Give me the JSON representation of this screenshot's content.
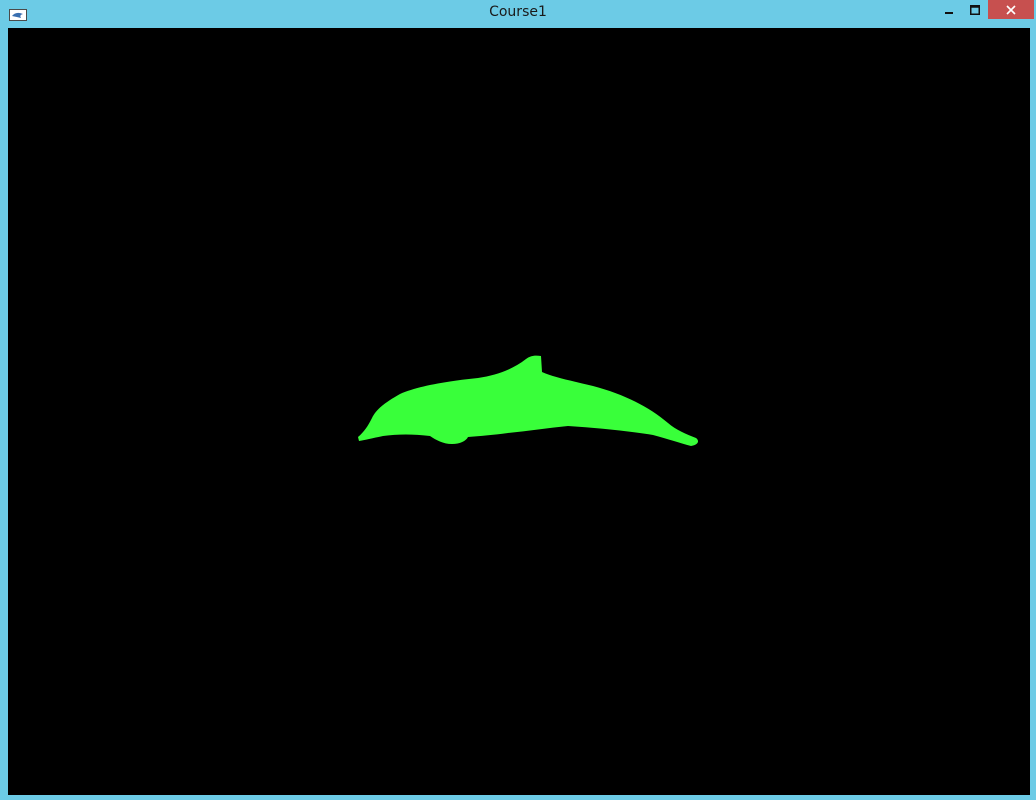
{
  "window": {
    "title": "Course1",
    "frame_color": "#6ccbe6",
    "close_color": "#c7504f"
  },
  "controls": {
    "minimize_icon": "minimize-icon",
    "maximize_icon": "maximize-icon",
    "close_icon": "close-icon"
  },
  "viewport": {
    "background": "#000000",
    "model": {
      "name_icon": "dolphin-silhouette",
      "color": "#39ff3a"
    }
  }
}
